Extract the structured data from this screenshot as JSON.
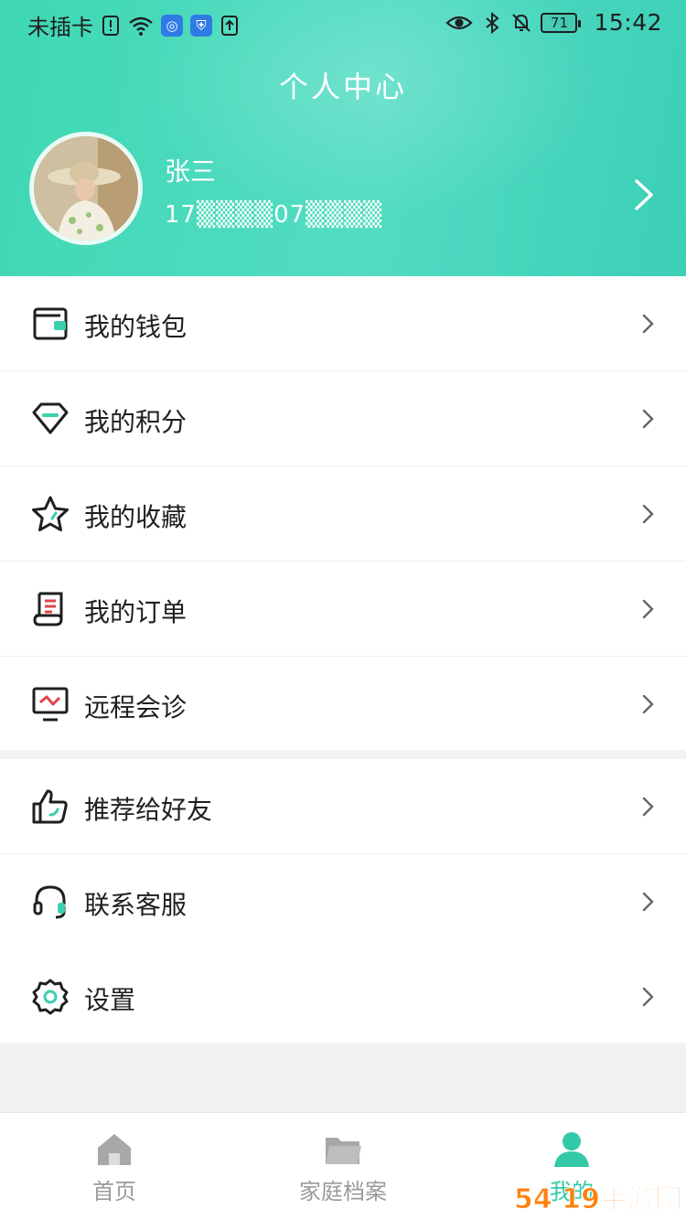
{
  "status_bar": {
    "carrier": "未插卡",
    "battery": "71",
    "time": "15:42"
  },
  "header": {
    "title": "个人中心",
    "user_name": "张三",
    "user_phone": "17▒▒▒▒07▒▒▒▒"
  },
  "menu_group_1": [
    {
      "label": "我的钱包",
      "icon": "wallet-icon"
    },
    {
      "label": "我的积分",
      "icon": "diamond-icon"
    },
    {
      "label": "我的收藏",
      "icon": "star-icon"
    },
    {
      "label": "我的订单",
      "icon": "order-receipt-icon"
    },
    {
      "label": "远程会诊",
      "icon": "monitor-consultation-icon"
    }
  ],
  "menu_group_2": [
    {
      "label": "推荐给好友",
      "icon": "thumbs-up-icon"
    },
    {
      "label": "联系客服",
      "icon": "headset-icon"
    },
    {
      "label": "设置",
      "icon": "gear-icon"
    }
  ],
  "tab_bar": {
    "tabs": [
      {
        "label": "首页",
        "icon": "home-icon",
        "active": false
      },
      {
        "label": "家庭档案",
        "icon": "folder-icon",
        "active": false
      },
      {
        "label": "我的",
        "icon": "user-icon",
        "active": true
      }
    ]
  },
  "watermark": "54 19手游网",
  "colors": {
    "accent": "#3fd8b3",
    "icon_accent": "#3ccfb0",
    "icon_red": "#e0454a",
    "text": "#1f1f1f",
    "inactive_tab": "#9a9a9a"
  }
}
